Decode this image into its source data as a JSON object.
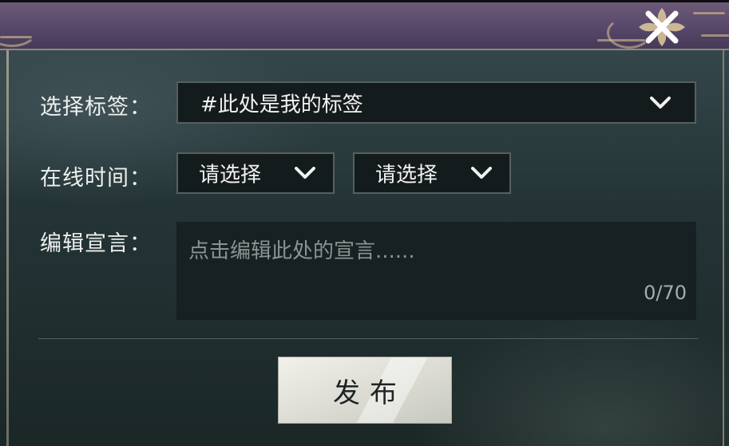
{
  "dialog": {
    "close_icon": "close-x-icon"
  },
  "tag": {
    "label": "选择标签：",
    "value": "#此处是我的标签",
    "icon": "chevron-down-icon"
  },
  "online_time": {
    "label": "在线时间：",
    "start_value": "请选择",
    "end_value": "请选择",
    "icon": "chevron-down-icon"
  },
  "declaration": {
    "label": "编辑宣言：",
    "placeholder": "点击编辑此处的宣言......",
    "counter": "0/70"
  },
  "publish_button": {
    "label": "发布"
  },
  "colors": {
    "header": "#57476a",
    "panel": "#243436",
    "input_bg": "#141b1c",
    "button_bg": "#e6e5de",
    "text": "#eef0ee"
  }
}
